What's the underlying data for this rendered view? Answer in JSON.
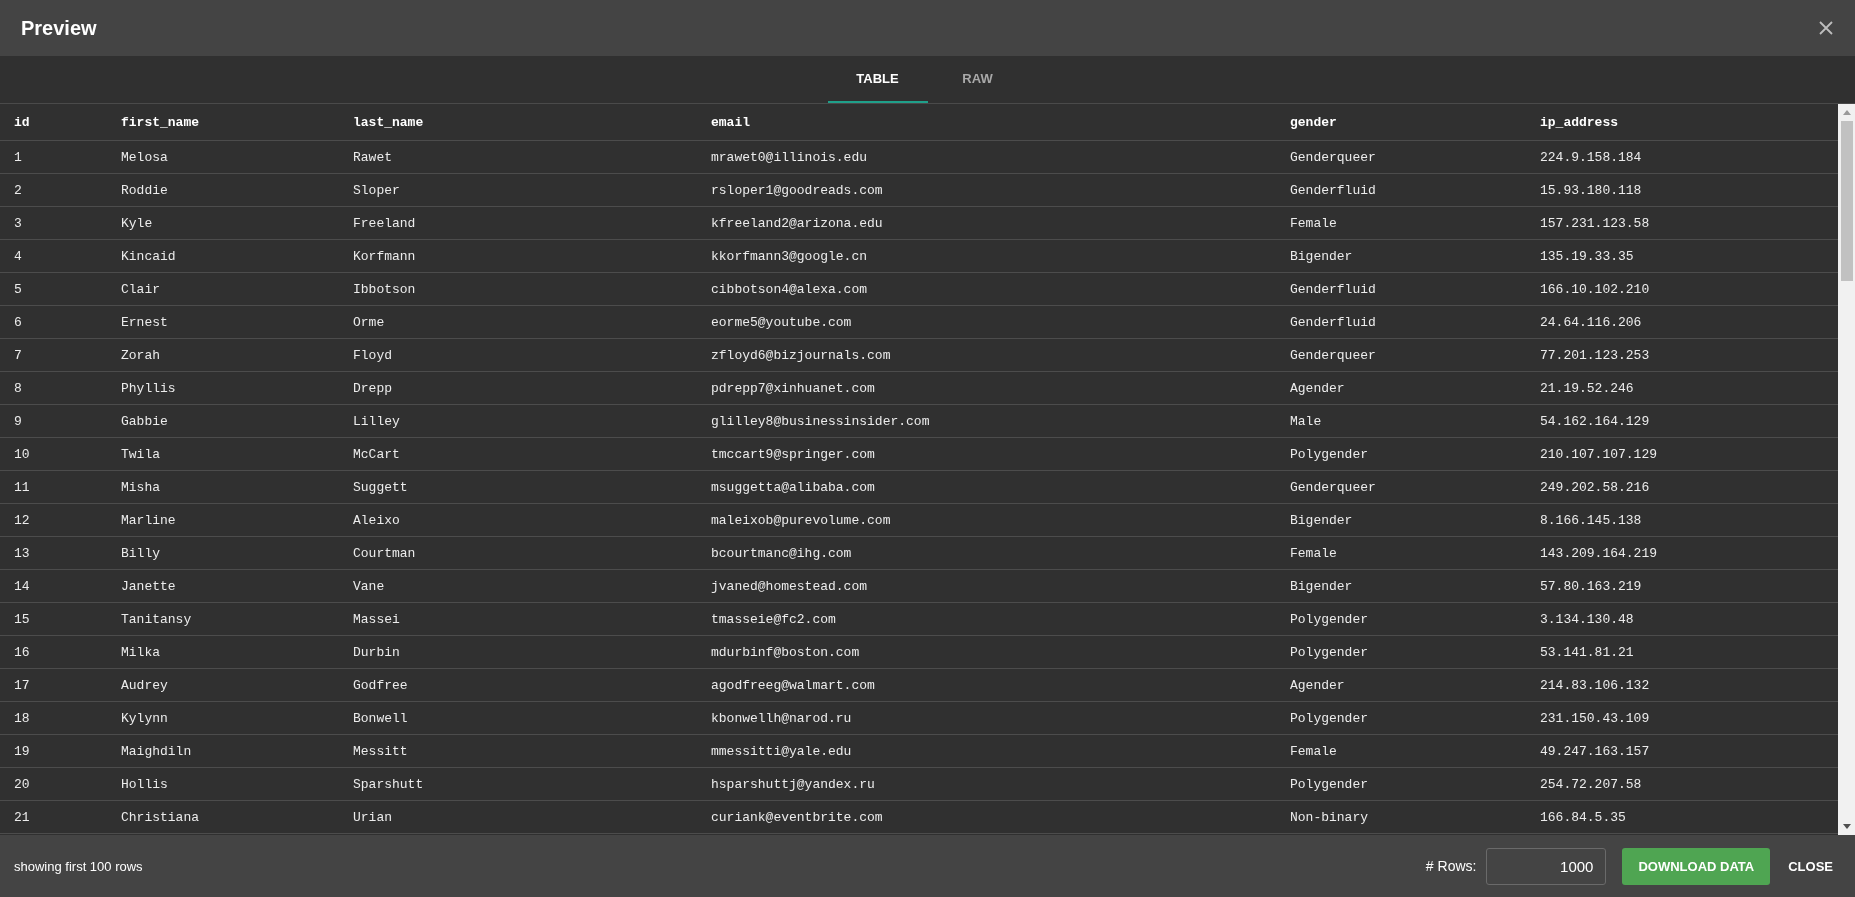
{
  "dialog": {
    "title": "Preview"
  },
  "tabs": [
    {
      "label": "TABLE",
      "selected": true
    },
    {
      "label": "RAW",
      "selected": false
    }
  ],
  "table": {
    "columns": [
      "id",
      "first_name",
      "last_name",
      "email",
      "gender",
      "ip_address"
    ],
    "rows": [
      [
        "1",
        "Melosa",
        "Rawet",
        "mrawet0@illinois.edu",
        "Genderqueer",
        "224.9.158.184"
      ],
      [
        "2",
        "Roddie",
        "Sloper",
        "rsloper1@goodreads.com",
        "Genderfluid",
        "15.93.180.118"
      ],
      [
        "3",
        "Kyle",
        "Freeland",
        "kfreeland2@arizona.edu",
        "Female",
        "157.231.123.58"
      ],
      [
        "4",
        "Kincaid",
        "Korfmann",
        "kkorfmann3@google.cn",
        "Bigender",
        "135.19.33.35"
      ],
      [
        "5",
        "Clair",
        "Ibbotson",
        "cibbotson4@alexa.com",
        "Genderfluid",
        "166.10.102.210"
      ],
      [
        "6",
        "Ernest",
        "Orme",
        "eorme5@youtube.com",
        "Genderfluid",
        "24.64.116.206"
      ],
      [
        "7",
        "Zorah",
        "Floyd",
        "zfloyd6@bizjournals.com",
        "Genderqueer",
        "77.201.123.253"
      ],
      [
        "8",
        "Phyllis",
        "Drepp",
        "pdrepp7@xinhuanet.com",
        "Agender",
        "21.19.52.246"
      ],
      [
        "9",
        "Gabbie",
        "Lilley",
        "glilley8@businessinsider.com",
        "Male",
        "54.162.164.129"
      ],
      [
        "10",
        "Twila",
        "McCart",
        "tmccart9@springer.com",
        "Polygender",
        "210.107.107.129"
      ],
      [
        "11",
        "Misha",
        "Suggett",
        "msuggetta@alibaba.com",
        "Genderqueer",
        "249.202.58.216"
      ],
      [
        "12",
        "Marline",
        "Aleixo",
        "maleixob@purevolume.com",
        "Bigender",
        "8.166.145.138"
      ],
      [
        "13",
        "Billy",
        "Courtman",
        "bcourtmanc@ihg.com",
        "Female",
        "143.209.164.219"
      ],
      [
        "14",
        "Janette",
        "Vane",
        "jvaned@homestead.com",
        "Bigender",
        "57.80.163.219"
      ],
      [
        "15",
        "Tanitansy",
        "Massei",
        "tmasseie@fc2.com",
        "Polygender",
        "3.134.130.48"
      ],
      [
        "16",
        "Milka",
        "Durbin",
        "mdurbinf@boston.com",
        "Polygender",
        "53.141.81.21"
      ],
      [
        "17",
        "Audrey",
        "Godfree",
        "agodfreeg@walmart.com",
        "Agender",
        "214.83.106.132"
      ],
      [
        "18",
        "Kylynn",
        "Bonwell",
        "kbonwellh@narod.ru",
        "Polygender",
        "231.150.43.109"
      ],
      [
        "19",
        "Maighdiln",
        "Messitt",
        "mmessitti@yale.edu",
        "Female",
        "49.247.163.157"
      ],
      [
        "20",
        "Hollis",
        "Sparshutt",
        "hsparshuttj@yandex.ru",
        "Polygender",
        "254.72.207.58"
      ],
      [
        "21",
        "Christiana",
        "Urian",
        "curiank@eventbrite.com",
        "Non-binary",
        "166.84.5.35"
      ]
    ]
  },
  "footer": {
    "note": "showing first 100 rows",
    "rows_label": "# Rows:",
    "rows_value": "1000",
    "download_button": "DOWNLOAD DATA",
    "close_button": "CLOSE"
  }
}
